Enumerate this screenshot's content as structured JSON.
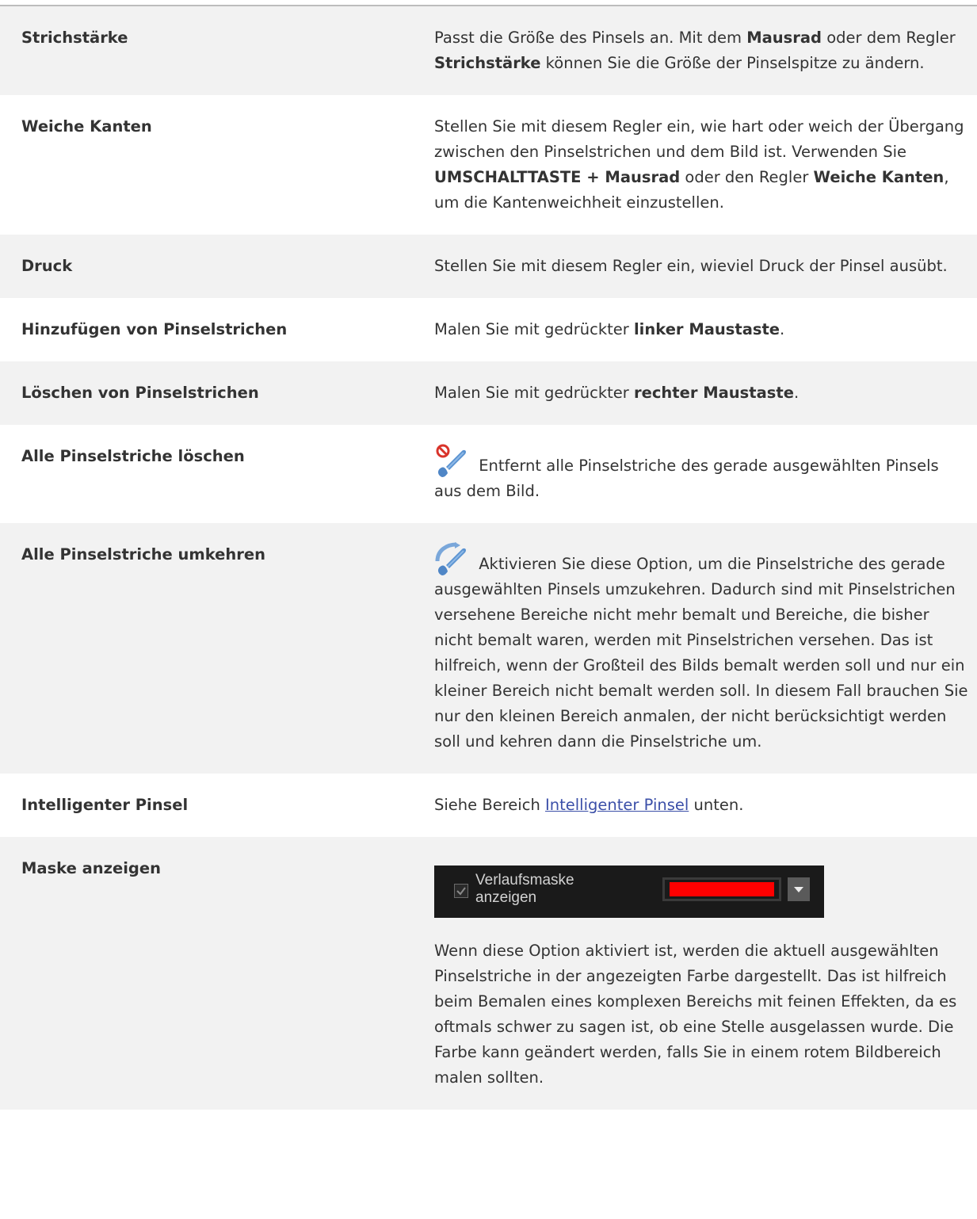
{
  "rows": [
    {
      "term": "Strichstärke",
      "segments": [
        "Passt die Größe des Pinsels an. Mit dem ",
        "Mausrad",
        " oder dem Regler ",
        "Strichstärke",
        " können Sie die Größe der Pinselspitze zu ändern."
      ]
    },
    {
      "term": "Weiche Kanten",
      "segments": [
        "Stellen Sie mit diesem Regler ein, wie hart oder weich der Übergang zwischen den Pinselstrichen und dem Bild ist. Verwenden Sie ",
        "UMSCHALTTASTE + Mausrad",
        " oder den Regler ",
        "Weiche Kanten",
        ", um die Kantenweichheit einzustellen."
      ]
    },
    {
      "term": "Druck",
      "text": "Stellen Sie mit diesem Regler ein, wieviel Druck der Pinsel ausübt."
    },
    {
      "term": "Hinzufügen von Pinselstrichen",
      "segments": [
        "Malen Sie mit gedrückter ",
        "linker Maustaste",
        "."
      ]
    },
    {
      "term": "Löschen von Pinselstrichen",
      "segments": [
        "Malen Sie mit gedrückter ",
        "rechter Maustaste",
        "."
      ]
    },
    {
      "term": "Alle Pinselstriche löschen",
      "icon": "clear-brush-strokes-icon",
      "text": " Entfernt alle Pinselstriche des gerade ausgewählten Pinsels aus dem Bild."
    },
    {
      "term": "Alle Pinselstriche umkehren",
      "icon": "invert-brush-strokes-icon",
      "text": " Aktivieren Sie diese Option, um die Pinselstriche des gerade ausgewählten Pinsels umzukehren. Dadurch sind mit Pinselstrichen versehene Bereiche nicht mehr bemalt und Bereiche, die bisher nicht bemalt waren, werden mit Pinselstrichen versehen. Das ist hilfreich, wenn der Großteil des Bilds bemalt werden soll und nur ein kleiner Bereich nicht bemalt werden soll. In diesem Fall brauchen Sie nur den kleinen Bereich anmalen, der nicht berücksichtigt werden soll und kehren dann die Pinselstriche um."
    },
    {
      "term": "Intelligenter Pinsel",
      "before": "Siehe Bereich ",
      "link": "Intelligenter Pinsel",
      "after": " unten."
    },
    {
      "term": "Maske anzeigen",
      "panel": {
        "checkbox_checked": true,
        "label_line1": "Verlaufsmaske",
        "label_line2": "anzeigen",
        "swatch_color": "#ff0000"
      },
      "text": "Wenn diese Option aktiviert ist, werden die aktuell ausgewählten Pinselstriche in der angezeigten Farbe dargestellt. Das ist hilfreich beim Bemalen eines komplexen Bereichs mit feinen Effekten, da es oftmals schwer zu sagen ist, ob eine Stelle ausgelassen wurde. Die Farbe kann geändert werden, falls Sie in einem rotem Bildbereich malen sollten."
    }
  ],
  "colors": {
    "row_shade": "#f2f2f2",
    "text": "#333333",
    "link": "#3b4fa8",
    "icon_blue": "#4f86c6",
    "icon_red": "#d9342b"
  }
}
